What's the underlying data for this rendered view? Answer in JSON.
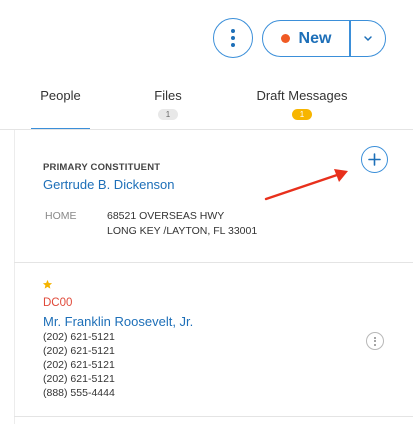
{
  "header": {
    "more_icon": "vertical-dots-icon",
    "new_button": {
      "label": "New",
      "dot_color": "#f05a24",
      "caret_icon": "chevron-down-icon"
    }
  },
  "tabs": [
    {
      "label": "People",
      "badge": "",
      "active": true
    },
    {
      "label": "Files",
      "badge": "1",
      "active": false
    },
    {
      "label": "Draft Messages",
      "badge": "1",
      "badge_color": "#f7b500",
      "active": false
    }
  ],
  "primary": {
    "section_label": "PRIMARY CONSTITUENT",
    "name": "Gertrude B. Dickenson",
    "address": {
      "type": "HOME",
      "line1": "68521 OVERSEAS HWY",
      "line2": "LONG KEY /LAYTON, FL 33001"
    },
    "add_icon": "plus-icon"
  },
  "contact": {
    "starred": true,
    "code": "DC00",
    "name": "Mr. Franklin Roosevelt, Jr.",
    "phones": [
      "(202) 621-5121",
      "(202) 621-5121",
      "(202) 621-5121",
      "(202) 621-5121",
      "(888) 555-4444"
    ]
  },
  "colors": {
    "accent": "#3b8fd9",
    "link": "#1d6fb8",
    "code": "#e04a3a",
    "arrow": "#e8301c",
    "star": "#f5b400"
  }
}
